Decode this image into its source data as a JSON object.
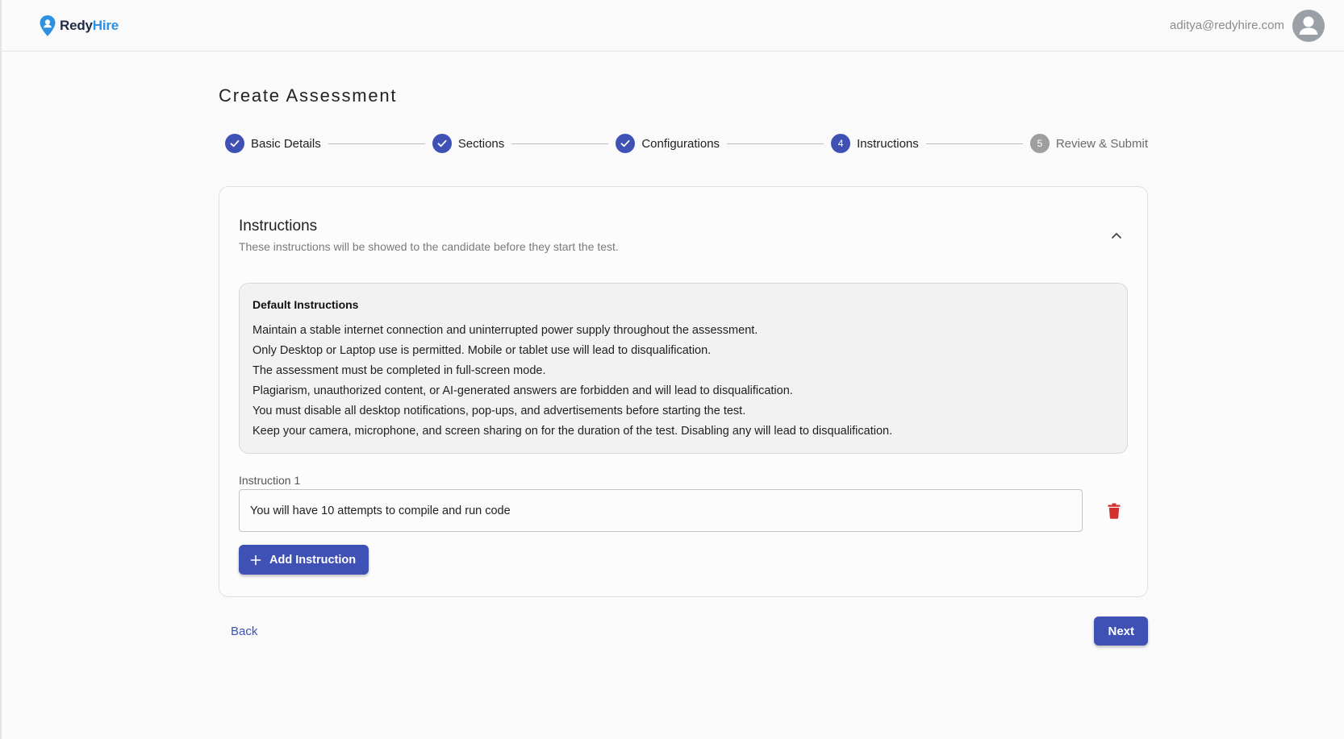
{
  "brand": {
    "name_part1": "Redy",
    "name_part2": "Hire",
    "accent": "#2f8fe0",
    "dark": "#1f2a44"
  },
  "header": {
    "user_email": "aditya@redyhire.com",
    "avatar_icon": "person-icon"
  },
  "page": {
    "title": "Create Assessment"
  },
  "stepper": {
    "steps": [
      {
        "label": "Basic Details",
        "state": "done"
      },
      {
        "label": "Sections",
        "state": "done"
      },
      {
        "label": "Configurations",
        "state": "done"
      },
      {
        "label": "Instructions",
        "state": "active",
        "number": "4"
      },
      {
        "label": "Review & Submit",
        "state": "pending",
        "number": "5"
      }
    ]
  },
  "instructions_card": {
    "title": "Instructions",
    "subtitle": "These instructions will be showed to the candidate before they start the test.",
    "default_instructions": {
      "title": "Default Instructions",
      "items": [
        "Maintain a stable internet connection and uninterrupted power supply throughout the assessment.",
        "Only Desktop or Laptop use is permitted. Mobile or tablet use will lead to disqualification.",
        "The assessment must be completed in full-screen mode.",
        "Plagiarism, unauthorized content, or AI-generated answers are forbidden and will lead to disqualification.",
        "You must disable all desktop notifications, pop-ups, and advertisements before starting the test.",
        "Keep your camera, microphone, and screen sharing on for the duration of the test. Disabling any will lead to disqualification."
      ]
    },
    "custom_instructions": [
      {
        "label": "Instruction 1",
        "value": "You will have 10 attempts to compile and run code"
      }
    ],
    "add_button_label": "Add Instruction"
  },
  "footer": {
    "back_label": "Back",
    "next_label": "Next"
  },
  "colors": {
    "primary": "#3f51b5",
    "danger": "#d32f2f",
    "pending": "#9e9e9e"
  }
}
